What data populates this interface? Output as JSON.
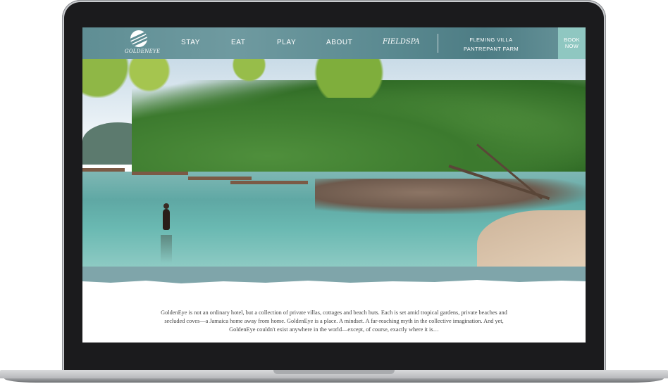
{
  "nav": {
    "logo_text": "GOLDENEYE",
    "links": [
      "STAY",
      "EAT",
      "PLAY",
      "ABOUT"
    ],
    "spa_label": "FIELDSPA",
    "property_links": [
      "FLEMING VILLA",
      "PANTREPANT FARM"
    ],
    "book_line1": "BOOK",
    "book_line2": "NOW"
  },
  "intro": {
    "text": "GoldenEye is not an ordinary hotel, but a collection of private villas, cottages and beach huts. Each is set amid tropical gardens, private beaches and secluded coves—a Jamaica home away from home. GoldenEye is a place. A mindset. A far-reaching myth in the collective imagination. And yet, GoldenEye couldn't exist anywhere in the world—except, of course, exactly where it is…"
  },
  "colors": {
    "nav_teal": "#5f8e94",
    "book_button": "#8fc7c1",
    "strip_teal": "#7fa5aa"
  },
  "icons": {
    "logo": "goldeneye-logo-icon"
  }
}
